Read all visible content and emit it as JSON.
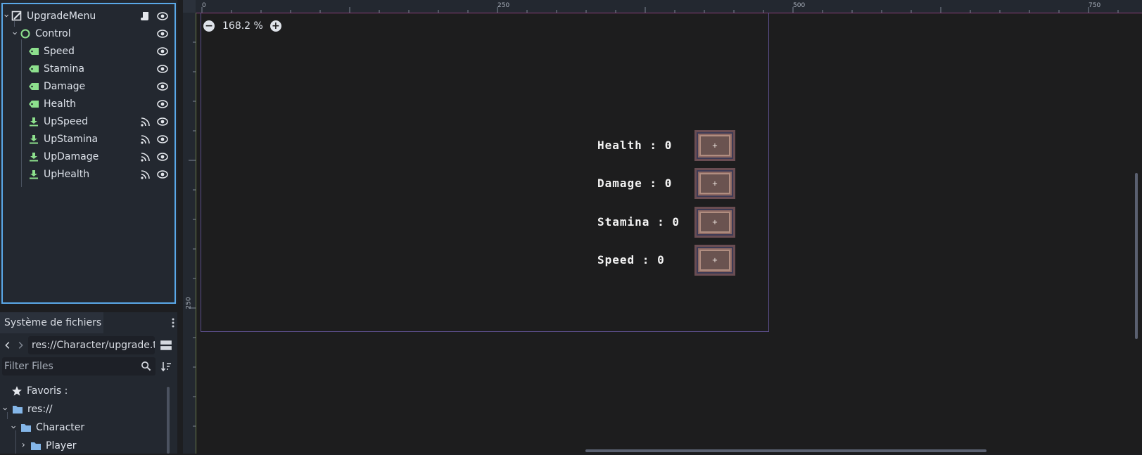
{
  "scene_tree": {
    "root": {
      "label": "UpgradeMenu"
    },
    "control": {
      "label": "Control"
    },
    "labels": [
      {
        "label": "Speed"
      },
      {
        "label": "Stamina"
      },
      {
        "label": "Damage"
      },
      {
        "label": "Health"
      }
    ],
    "buttons": [
      {
        "label": "UpSpeed"
      },
      {
        "label": "UpStamina"
      },
      {
        "label": "UpDamage"
      },
      {
        "label": "UpHealth"
      }
    ]
  },
  "filesystem": {
    "tab_label": "Système de fichiers",
    "path": "res://Character/upgrade.t",
    "filter_placeholder": "Filter Files",
    "favorites_label": "Favoris :",
    "items": [
      {
        "label": "res://"
      },
      {
        "label": "Character"
      },
      {
        "label": "Player"
      }
    ]
  },
  "viewport": {
    "zoom": "168.2 %",
    "ruler_top": [
      "0",
      "250",
      "500",
      "750"
    ],
    "ruler_left": [
      "250"
    ]
  },
  "game_ui": {
    "rows": [
      {
        "text": "Health : 0",
        "button": "+"
      },
      {
        "text": "Damage : 0",
        "button": "+"
      },
      {
        "text": "Stamina : 0",
        "button": "+"
      },
      {
        "text": "Speed : 0",
        "button": "+"
      }
    ]
  },
  "colors": {
    "accent": "#5aa8e8",
    "node_green": "#8de08d",
    "folder_blue": "#84b6e8"
  }
}
